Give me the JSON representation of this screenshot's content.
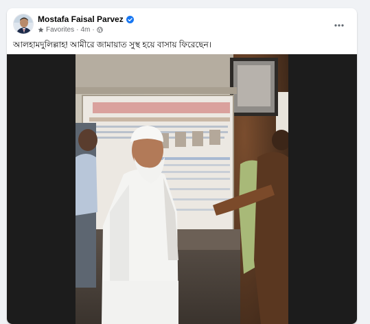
{
  "post": {
    "author": "Mostafa Faisal Parvez",
    "audience": "Favorites",
    "separator": "·",
    "time": "4m",
    "text": "আলহামদুলিল্লাহ! আমীরে জামায়াত সুস্থ হয়ে বাসায় ফিরেছেন।",
    "verified_color": "#1877f2"
  },
  "icons": {
    "star": "star-icon",
    "globe": "globe-icon",
    "more": "more-options-icon",
    "verified": "verified-badge-icon"
  }
}
